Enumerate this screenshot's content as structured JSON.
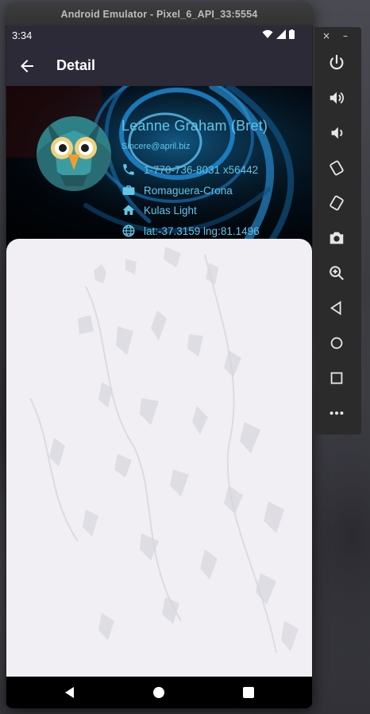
{
  "window": {
    "title": "Android Emulator - Pixel_6_API_33:5554"
  },
  "status_bar": {
    "time": "3:34"
  },
  "app_bar": {
    "title": "Detail"
  },
  "profile": {
    "name": "Leanne Graham (Bret)",
    "email": "Sincere@april.biz",
    "phone": "1-770-736-8031 x56442",
    "company": "Romaguera-Crona",
    "street": "Kulas Light",
    "geo": "lat:-37.3159 lng:81.1496",
    "accent_color": "#63c6e6"
  },
  "emulator_toolbar": {
    "window_controls": {
      "close": "×",
      "minimize": "–"
    },
    "tools": [
      "power-icon",
      "volume-up-icon",
      "volume-down-icon",
      "rotate-left-icon",
      "rotate-right-icon",
      "camera-icon",
      "zoom-icon",
      "back-icon",
      "home-icon",
      "overview-icon",
      "more-icon"
    ]
  },
  "nav_bar": {
    "buttons": [
      "back",
      "home",
      "recents"
    ]
  }
}
